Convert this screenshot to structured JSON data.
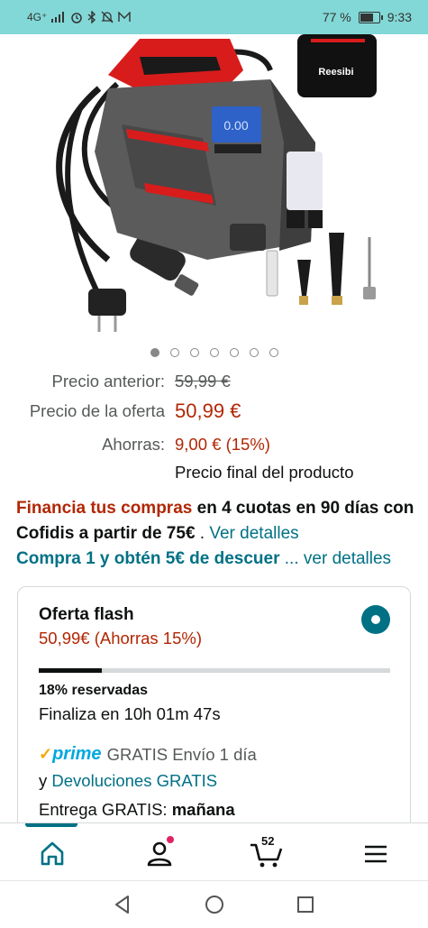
{
  "status_bar": {
    "network": "4G⁺",
    "battery": "77 %",
    "battery_level": 0.77,
    "time": "9:33"
  },
  "product_image": {
    "brand": "Reesibi",
    "image_count": 7,
    "active_index": 0
  },
  "pricing": {
    "previous_label": "Precio anterior:",
    "previous_value": "59,99 €",
    "deal_label": "Precio de la oferta",
    "deal_value": "50,99 €",
    "savings_label": "Ahorras:",
    "savings_value": "9,00 € (15%)",
    "final_note": "Precio final del producto"
  },
  "financing": {
    "highlight": "Financia tus compras",
    "text": " en 4 cuotas en 90 días con Cofidis a partir de 75€",
    "suffix": " . ",
    "link": "Ver detalles"
  },
  "coupon": {
    "text": "Compra 1 y obtén 5€ de descuer",
    "link": "... ver detalles"
  },
  "flash_offer": {
    "title": "Oferta flash",
    "price": "50,99€ (Ahorras 15%)",
    "claimed_fraction": 0.18,
    "claimed_text": "18% reservadas",
    "ends_text": "Finaliza en 10h 01m 47s",
    "prime_label": "prime",
    "shipping": "GRATIS Envío 1 día",
    "returns_prefix": "y ",
    "returns_link": "Devoluciones GRATIS",
    "delivery_prefix": "Entrega GRATIS: ",
    "delivery_day": "mañana"
  },
  "bottom_nav": {
    "cart_count": "52",
    "items": [
      "home-icon",
      "account-icon",
      "cart-icon",
      "menu-icon"
    ]
  },
  "colors": {
    "status_bar": "#82d8d6",
    "price_red": "#b12704",
    "link_teal": "#007185",
    "prime_blue": "#00a8e1"
  }
}
